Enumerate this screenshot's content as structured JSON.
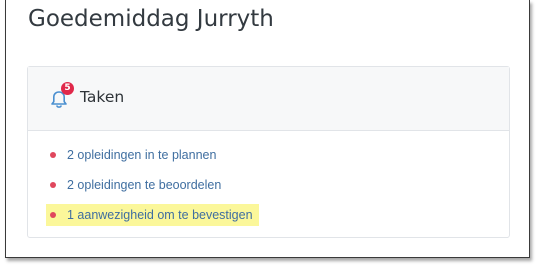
{
  "greeting": "Goedemiddag Jurryth",
  "tasks_card": {
    "title": "Taken",
    "badge_count": "5",
    "items": [
      {
        "label": "2 opleidingen in te plannen",
        "highlighted": false
      },
      {
        "label": "2 opleidingen te beoordelen",
        "highlighted": false
      },
      {
        "label": "1 aanwezigheid om te bevestigen",
        "highlighted": true
      }
    ]
  },
  "colors": {
    "bullet": "#e0475d",
    "badge": "#e0284a",
    "link": "#3f6ea0",
    "highlight": "#fbf79a",
    "header_bg": "#f7f8f9"
  },
  "icons": {
    "header_icon": "bell-icon"
  }
}
